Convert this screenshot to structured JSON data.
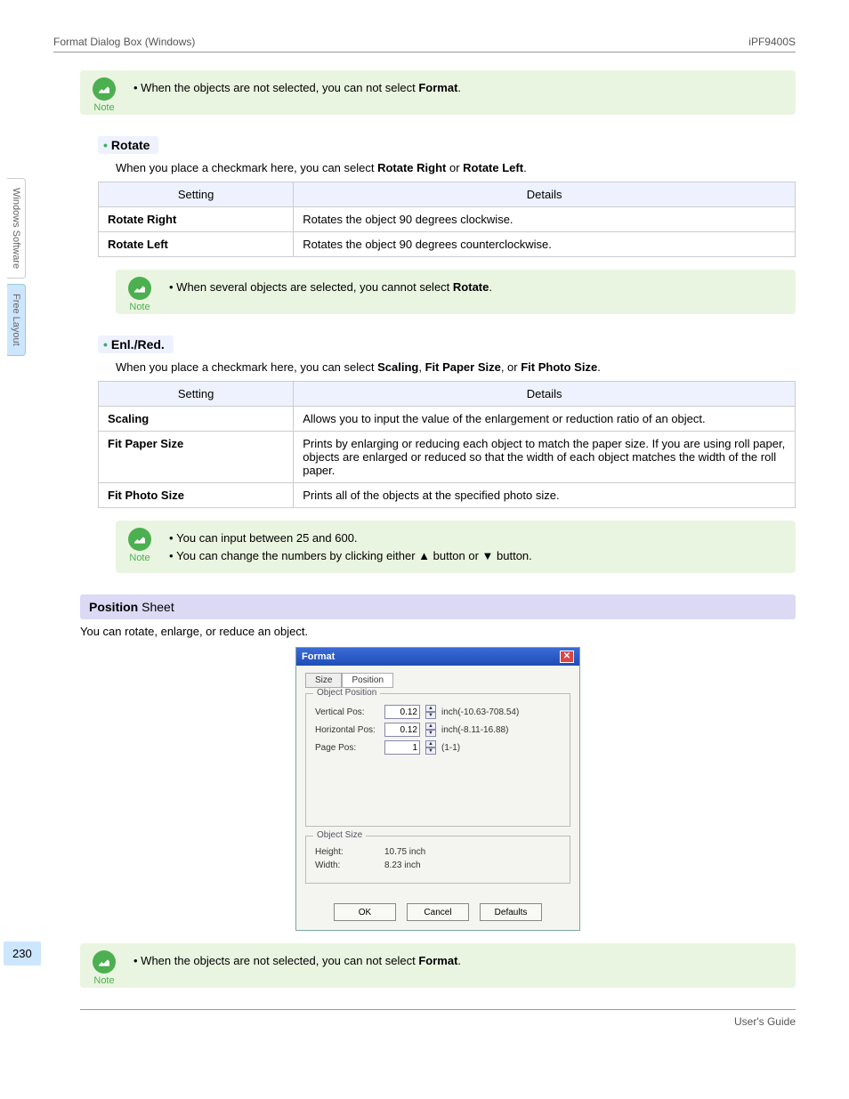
{
  "header": {
    "left": "Format Dialog Box (Windows)",
    "right": "iPF9400S"
  },
  "sideTabs": {
    "t1": "Windows Software",
    "t2": "Free Layout"
  },
  "note1": {
    "label": "Note",
    "line1_pre": "When the objects are not selected, you can not select ",
    "line1_bold": "Format",
    "line1_post": "."
  },
  "rotate": {
    "heading": "Rotate",
    "desc_pre": "When you place a checkmark here, you can select ",
    "desc_b1": "Rotate Right",
    "desc_mid": " or ",
    "desc_b2": "Rotate Left",
    "desc_post": ".",
    "th1": "Setting",
    "th2": "Details",
    "r1c1": "Rotate Right",
    "r1c2": "Rotates the object 90 degrees clockwise.",
    "r2c1": "Rotate Left",
    "r2c2": "Rotates the object 90 degrees counterclockwise."
  },
  "note2": {
    "label": "Note",
    "line1_pre": "When several objects are selected, you cannot select ",
    "line1_bold": "Rotate",
    "line1_post": "."
  },
  "enlred": {
    "heading": "Enl./Red.",
    "desc_pre": "When you place a checkmark here, you can select ",
    "desc_b1": "Scaling",
    "desc_mid1": ", ",
    "desc_b2": "Fit Paper Size",
    "desc_mid2": ", or ",
    "desc_b3": "Fit Photo Size",
    "desc_post": ".",
    "th1": "Setting",
    "th2": "Details",
    "r1c1": "Scaling",
    "r1c2": "Allows you to input the value of the enlargement or reduction ratio of an object.",
    "r2c1": "Fit Paper Size",
    "r2c2": "Prints by enlarging or reducing each object to match the paper size. If you are using roll paper, objects are enlarged or reduced so that the width of each object matches the width of the roll paper.",
    "r3c1": "Fit Photo Size",
    "r3c2": "Prints all of the objects at the specified photo size."
  },
  "note3": {
    "label": "Note",
    "line1": "You can input between 25 and 600.",
    "line2": "You can change the numbers by clicking either ▲ button or ▼ button."
  },
  "section": {
    "bold": "Position",
    "rest": " Sheet",
    "intro": "You can rotate, enlarge, or reduce an object."
  },
  "dialog": {
    "title": "Format",
    "tab1": "Size",
    "tab2": "Position",
    "fs1_legend": "Object Position",
    "vpos_label": "Vertical Pos:",
    "vpos_val": "0.12",
    "vpos_suffix": "inch(-10.63-708.54)",
    "hpos_label": "Horizontal Pos:",
    "hpos_val": "0.12",
    "hpos_suffix": "inch(-8.11-16.88)",
    "ppos_label": "Page Pos:",
    "ppos_val": "1",
    "ppos_suffix": "(1-1)",
    "fs2_legend": "Object Size",
    "height_label": "Height:",
    "height_val": "10.75 inch",
    "width_label": "Width:",
    "width_val": "8.23 inch",
    "ok": "OK",
    "cancel": "Cancel",
    "defaults": "Defaults"
  },
  "note4": {
    "label": "Note",
    "line1_pre": "When the objects are not selected, you can not select ",
    "line1_bold": "Format",
    "line1_post": "."
  },
  "pageNum": "230",
  "footer": "User's Guide"
}
